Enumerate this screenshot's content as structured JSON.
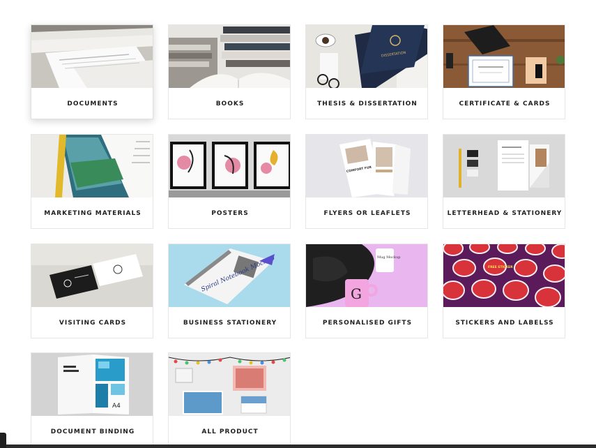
{
  "categories": [
    {
      "label": "DOCUMENTS"
    },
    {
      "label": "BOOKS"
    },
    {
      "label": "THESIS & DISSERTATION"
    },
    {
      "label": "CERTIFICATE & CARDS"
    },
    {
      "label": "MARKETING MATERIALS"
    },
    {
      "label": "POSTERS"
    },
    {
      "label": "FLYERS OR LEAFLETS"
    },
    {
      "label": "LETTERHEAD & STATIONERY"
    },
    {
      "label": "VISITING CARDS"
    },
    {
      "label": "BUSINESS STATIONERY"
    },
    {
      "label": "PERSONALISED GIFTS"
    },
    {
      "label": "STICKERS AND LABELSS"
    },
    {
      "label": "DOCUMENT BINDING"
    },
    {
      "label": "ALL PRODUCT"
    }
  ],
  "thumb_text": {
    "thesis_cover": "DISSERTATION",
    "flyer_heading": "COMFORT FURNITURE",
    "spiral_title": "Spiral Notebook Mockup",
    "mug_letter": "G",
    "mug_text": "Mug Mockup",
    "sticker_text": "FREE STICKER",
    "binding_page": "A4"
  },
  "colors": {
    "label_text": "#222222",
    "card_border": "#e6e6e6",
    "sticker_red": "#d8323a",
    "sticker_bg": "#5b1a5a",
    "spiral_bg": "#a9dbec",
    "gift_bg": "#e9b6f0"
  }
}
